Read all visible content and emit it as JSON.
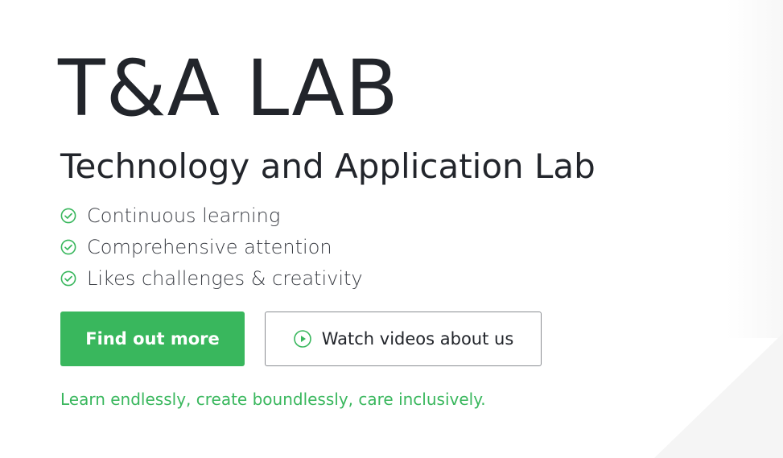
{
  "colors": {
    "accent": "#39b75d",
    "text": "#22252b",
    "button_border": "#8a8d92"
  },
  "hero": {
    "title": "T&A LAB",
    "subtitle": "Technology and Application Lab",
    "features": [
      {
        "icon": "check-circle-icon",
        "label": "Continuous learning"
      },
      {
        "icon": "check-circle-icon",
        "label": "Comprehensive attention"
      },
      {
        "icon": "check-circle-icon",
        "label": "Likes challenges & creativity"
      }
    ],
    "primary_button": {
      "label": "Find out more"
    },
    "secondary_button": {
      "icon": "play-circle-icon",
      "label": "Watch videos about us"
    },
    "tagline": "Learn endlessly, create boundlessly, care inclusively."
  }
}
